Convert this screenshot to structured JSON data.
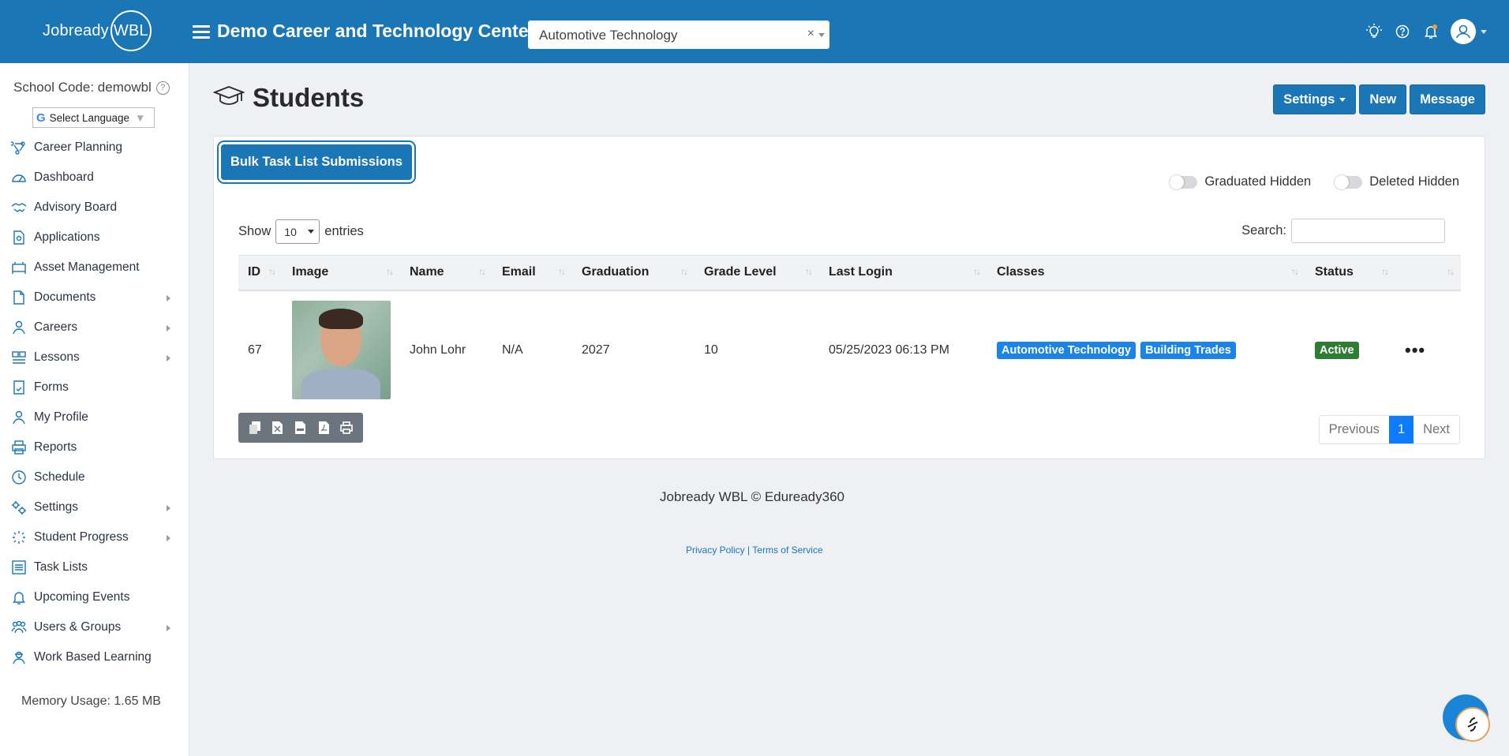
{
  "app": {
    "logo_text": "Jobready",
    "logo_circle": "WBL",
    "org_title": "Demo Career and Technology Center",
    "class_select_value": "Automotive Technology",
    "class_select_clear": "×",
    "brand_color": "#1a76b5"
  },
  "sidebar": {
    "school_code": "School Code: demowbl",
    "help_mark": "?",
    "language_label": "Select Language",
    "language_g": "G",
    "language_arrow": "▼",
    "items": [
      {
        "label": "Career Planning",
        "icon": "career-planning-icon"
      },
      {
        "label": "Dashboard",
        "icon": "dashboard-icon"
      },
      {
        "label": "Advisory Board",
        "icon": "handshake-icon"
      },
      {
        "label": "Applications",
        "icon": "applications-icon"
      },
      {
        "label": "Asset Management",
        "icon": "asset-icon"
      },
      {
        "label": "Documents",
        "icon": "document-icon",
        "expandable": true
      },
      {
        "label": "Careers",
        "icon": "careers-icon",
        "expandable": true
      },
      {
        "label": "Lessons",
        "icon": "lessons-icon",
        "expandable": true
      },
      {
        "label": "Forms",
        "icon": "forms-icon"
      },
      {
        "label": "My Profile",
        "icon": "profile-icon"
      },
      {
        "label": "Reports",
        "icon": "printer-icon"
      },
      {
        "label": "Schedule",
        "icon": "clock-icon"
      },
      {
        "label": "Settings",
        "icon": "gears-icon",
        "expandable": true
      },
      {
        "label": "Student Progress",
        "icon": "progress-icon",
        "expandable": true
      },
      {
        "label": "Task Lists",
        "icon": "list-icon"
      },
      {
        "label": "Upcoming Events",
        "icon": "bell-icon"
      },
      {
        "label": "Users & Groups",
        "icon": "users-icon",
        "expandable": true
      },
      {
        "label": "Work Based Learning",
        "icon": "worker-icon"
      }
    ],
    "memory": "Memory Usage: 1.65 MB"
  },
  "main": {
    "title": "Students",
    "buttons": {
      "settings": "Settings",
      "new": "New",
      "message": "Message"
    },
    "bulk_button": "Bulk Task List Submissions",
    "toggles": {
      "graduated": "Graduated Hidden",
      "deleted": "Deleted Hidden"
    },
    "show_label": "Show",
    "show_value": "10",
    "entries_label": "entries",
    "search_label": "Search:",
    "columns": [
      "ID",
      "Image",
      "Name",
      "Email",
      "Graduation",
      "Grade Level",
      "Last Login",
      "Classes",
      "Status",
      ""
    ],
    "sort_glyph": "↑↓",
    "rows": [
      {
        "id": "67",
        "name": "John Lohr",
        "email": "N/A",
        "graduation": "2027",
        "grade_level": "10",
        "last_login": "05/25/2023 06:13 PM",
        "classes": [
          "Automotive Technology",
          "Building Trades"
        ],
        "status": "Active",
        "actions": "•••"
      }
    ],
    "export_icons": [
      "copy-icon",
      "excel-icon",
      "csv-icon",
      "pdf-icon",
      "print-icon"
    ],
    "pager": {
      "previous": "Previous",
      "current": "1",
      "next": "Next"
    }
  },
  "footer": {
    "text": "Jobready WBL © Eduready360",
    "privacy": "Privacy Policy",
    "separator": "|",
    "terms": "Terms of Service"
  }
}
